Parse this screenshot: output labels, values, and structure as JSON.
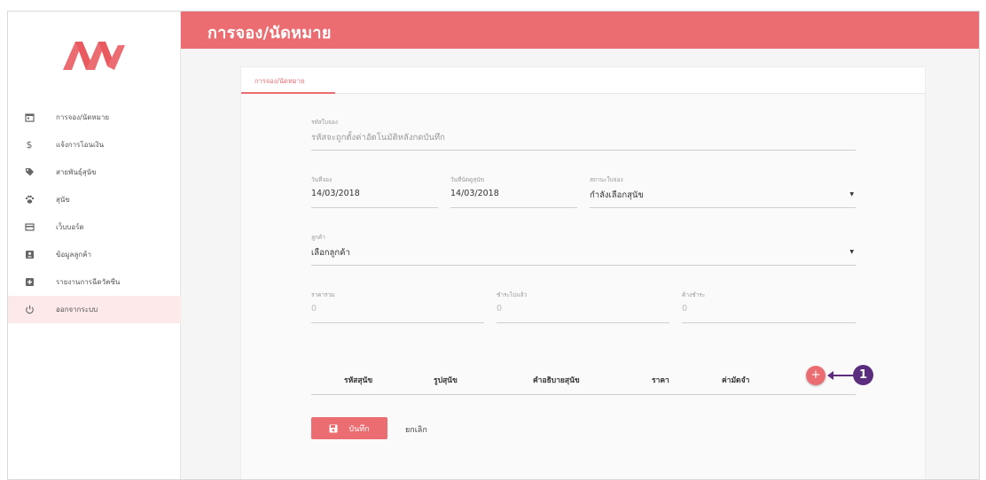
{
  "header": {
    "title": "การจอง/นัดหมาย"
  },
  "brand": {
    "accent": "#ec6d71",
    "callout": "#5b2d7f"
  },
  "sidebar": {
    "items": [
      {
        "label": "การจอง/นัดหมาย",
        "icon": "calendar-icon"
      },
      {
        "label": "แจ้งการโอนเงิน",
        "icon": "dollar-icon"
      },
      {
        "label": "สายพันธุ์สุนัข",
        "icon": "tag-icon"
      },
      {
        "label": "สุนัข",
        "icon": "paw-icon"
      },
      {
        "label": "เว็บบอร์ด",
        "icon": "card-icon"
      },
      {
        "label": "ข้อมูลลูกค้า",
        "icon": "account-box-icon"
      },
      {
        "label": "รายงานการฉีดวัคซีน",
        "icon": "plus-box-icon"
      },
      {
        "label": "ออกจากระบบ",
        "icon": "power-icon"
      }
    ]
  },
  "tab": {
    "label": "การจอง/นัดหมาย"
  },
  "form": {
    "booking_id": {
      "label": "รหัสใบจอง",
      "placeholder": "รหัสจะถูกตั้งค่าอัตโนมัติหลังกดบันทึก"
    },
    "booking_date": {
      "label": "วันที่จอง",
      "value": "14/03/2018"
    },
    "appointment_date": {
      "label": "วันที่นัดดูสุนัข",
      "value": "14/03/2018"
    },
    "status": {
      "label": "สถานะใบจอง",
      "value": "กำลังเลือกสุนัข"
    },
    "customer": {
      "label": "ลูกค้า",
      "value": "เลือกลูกค้า"
    },
    "total": {
      "label": "ราคารวม",
      "value": "0"
    },
    "paid": {
      "label": "ชำระไปแล้ว",
      "value": "0"
    },
    "balance": {
      "label": "ค้างชำระ",
      "value": "0"
    }
  },
  "table": {
    "columns": [
      "รหัสสุนัข",
      "รูปสุนัข",
      "คำอธิบายสุนัข",
      "ราคา",
      "ค่ามัดจำ"
    ],
    "add_label": "+"
  },
  "callout": {
    "number": "1"
  },
  "actions": {
    "save_label": "บันทึก",
    "cancel_label": "ยกเลิก"
  }
}
